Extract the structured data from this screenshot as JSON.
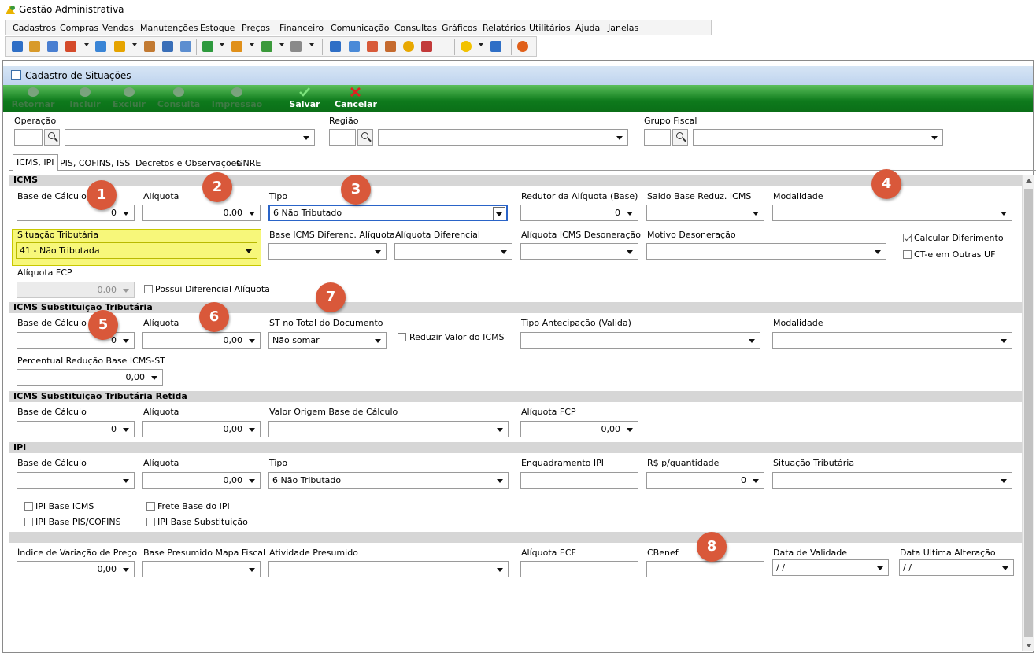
{
  "app": {
    "title": "Gestão Administrativa"
  },
  "menu": [
    "Cadastros",
    "Compras",
    "Vendas",
    "Manutenções",
    "Estoque",
    "Preços",
    "Financeiro",
    "Comunicação",
    "Consultas",
    "Gráficos",
    "Relatórios",
    "Utilitários",
    "Ajuda",
    "Janelas"
  ],
  "window": {
    "title": "Cadastro de Situações"
  },
  "actions": {
    "retornar": "Retornar",
    "incluir": "Incluir",
    "excluir": "Excluir",
    "consulta": "Consulta",
    "impressao": "Impressão",
    "salvar": "Salvar",
    "cancelar": "Cancelar"
  },
  "top": {
    "operacao": "Operação",
    "regiao": "Região",
    "grupo_fiscal": "Grupo Fiscal"
  },
  "tabs": [
    "ICMS, IPI",
    "PIS, COFINS, ISS",
    "Decretos e Observações",
    "GNRE"
  ],
  "icms": {
    "section": "ICMS",
    "base_calculo": "Base de Cálculo",
    "base_calculo_value": "0",
    "aliquota": "Alíquota",
    "aliquota_value": "0,00",
    "tipo": "Tipo",
    "tipo_value": "6 Não Tributado",
    "redutor": "Redutor da Alíquota (Base)",
    "redutor_value": "0",
    "saldo_base": "Saldo Base Reduz. ICMS",
    "modalidade": "Modalidade",
    "situacao": "Situação Tributária",
    "situacao_value": "41 - Não Tributada",
    "base_difer": "Base ICMS Diferenc. Alíquota",
    "aliq_difer": "Alíquota Diferencial",
    "aliq_desoneracao": "Alíquota ICMS Desoneração",
    "motivo_desoneracao": "Motivo Desoneração",
    "calc_diferimento": "Calcular Diferimento",
    "cte_outras": "CT-e em Outras UF",
    "aliq_fcp": "Alíquota FCP",
    "aliq_fcp_value": "0,00",
    "possui_difer": "Possui Diferencial Alíquota"
  },
  "icms_st": {
    "section": "ICMS Substituição Tributária",
    "base_calculo": "Base de Cálculo",
    "base_calculo_value": "0",
    "aliquota": "Alíquota",
    "aliquota_value": "0,00",
    "st_total": "ST no Total do Documento",
    "st_total_value": "Não somar",
    "reduzir": "Reduzir Valor do ICMS",
    "tipo_antecipacao": "Tipo Antecipação (Valida)",
    "modalidade": "Modalidade",
    "perc_reducao": "Percentual Redução Base ICMS-ST",
    "perc_reducao_value": "0,00"
  },
  "icms_st_retida": {
    "section": "ICMS Substituição Tributária Retida",
    "base_calculo": "Base de Cálculo",
    "base_calculo_value": "0",
    "aliquota": "Alíquota",
    "aliquota_value": "0,00",
    "valor_origem": "Valor Origem Base de Cálculo",
    "aliq_fcp": "Alíquota FCP",
    "aliq_fcp_value": "0,00"
  },
  "ipi": {
    "section": "IPI",
    "base_calculo": "Base de Cálculo",
    "aliquota": "Alíquota",
    "aliquota_value": "0,00",
    "tipo": "Tipo",
    "tipo_value": "6 Não Tributado",
    "enquadramento": "Enquadramento IPI",
    "rs_quantidade": "R$ p/quantidade",
    "rs_quantidade_value": "0",
    "situacao": "Situação Tributária",
    "chk_base_icms": "IPI Base ICMS",
    "chk_frete": "Frete Base do IPI",
    "chk_base_pis": "IPI Base PIS/COFINS",
    "chk_base_subst": "IPI Base Substituição"
  },
  "other": {
    "indice_variacao": "Índice de Variação de Preço",
    "indice_variacao_value": "0,00",
    "base_presumido": "Base Presumido Mapa Fiscal",
    "atividade_presumido": "Atividade Presumido",
    "aliq_ecf": "Alíquota ECF",
    "cbenef": "CBenef",
    "data_validade": "Data de Validade",
    "data_validade_value": " /  /",
    "data_alteracao": "Data Ultima Alteração",
    "data_alteracao_value": " /  /"
  },
  "badges": [
    "1",
    "2",
    "3",
    "4",
    "5",
    "6",
    "7",
    "8"
  ]
}
